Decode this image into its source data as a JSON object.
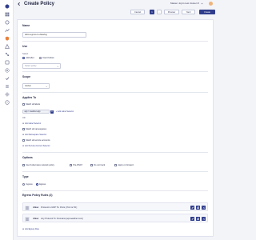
{
  "header": {
    "title": "Create Policy",
    "workspace": "Master Jojo's test cluster-8"
  },
  "toolbar": {
    "cancel": "Cancel",
    "step": "1",
    "preview": "Preview",
    "yaml": "Yaml",
    "create": "Create"
  },
  "form": {
    "name_title": "Name",
    "name_value": "allow-egress-to-datadog",
    "use_title": "Use",
    "select_label": "Select",
    "radio_add": "Add after",
    "radio_insert": "Insert before",
    "select_placeholder": "Select policy",
    "scope_title": "Scope",
    "scope_value": "Global"
  },
  "applies_to": {
    "title": "Applies To",
    "match_all_labels": "Match all labels",
    "chip_text": "app = weather-app",
    "add_label": "+ Add Label Selector",
    "or_text": "OR",
    "add_label_link": "Add Label Selector",
    "match_all_namespaces": "Match all namespaces",
    "add_ns_link": "Add Namespace Selector",
    "match_all_sa": "Match all service accounts",
    "add_sa_link": "Add Service Account Selector"
  },
  "options": {
    "title": "Options",
    "opt1": "Use Kubernetes network policy",
    "opt2": "Pre-DNAT",
    "opt3": "Do not track",
    "opt4": "Apply on forward"
  },
  "types": {
    "title": "Type",
    "ingress": "Ingress",
    "egress": "Egress"
  },
  "rules": {
    "title": "Egress Policy Rules (2)",
    "items": [
      {
        "action": "Allow",
        "text": "Protocol is UDP  To:  Ports [ Port is 53 ]"
      },
      {
        "action": "Allow",
        "text": "Any Protocol  To:  Domains [api.weather.com]"
      }
    ],
    "add_rule": "Add Egress Rule"
  },
  "colors": {
    "primary": "#2f3d8c",
    "accent_orange": "#f0b37a"
  }
}
